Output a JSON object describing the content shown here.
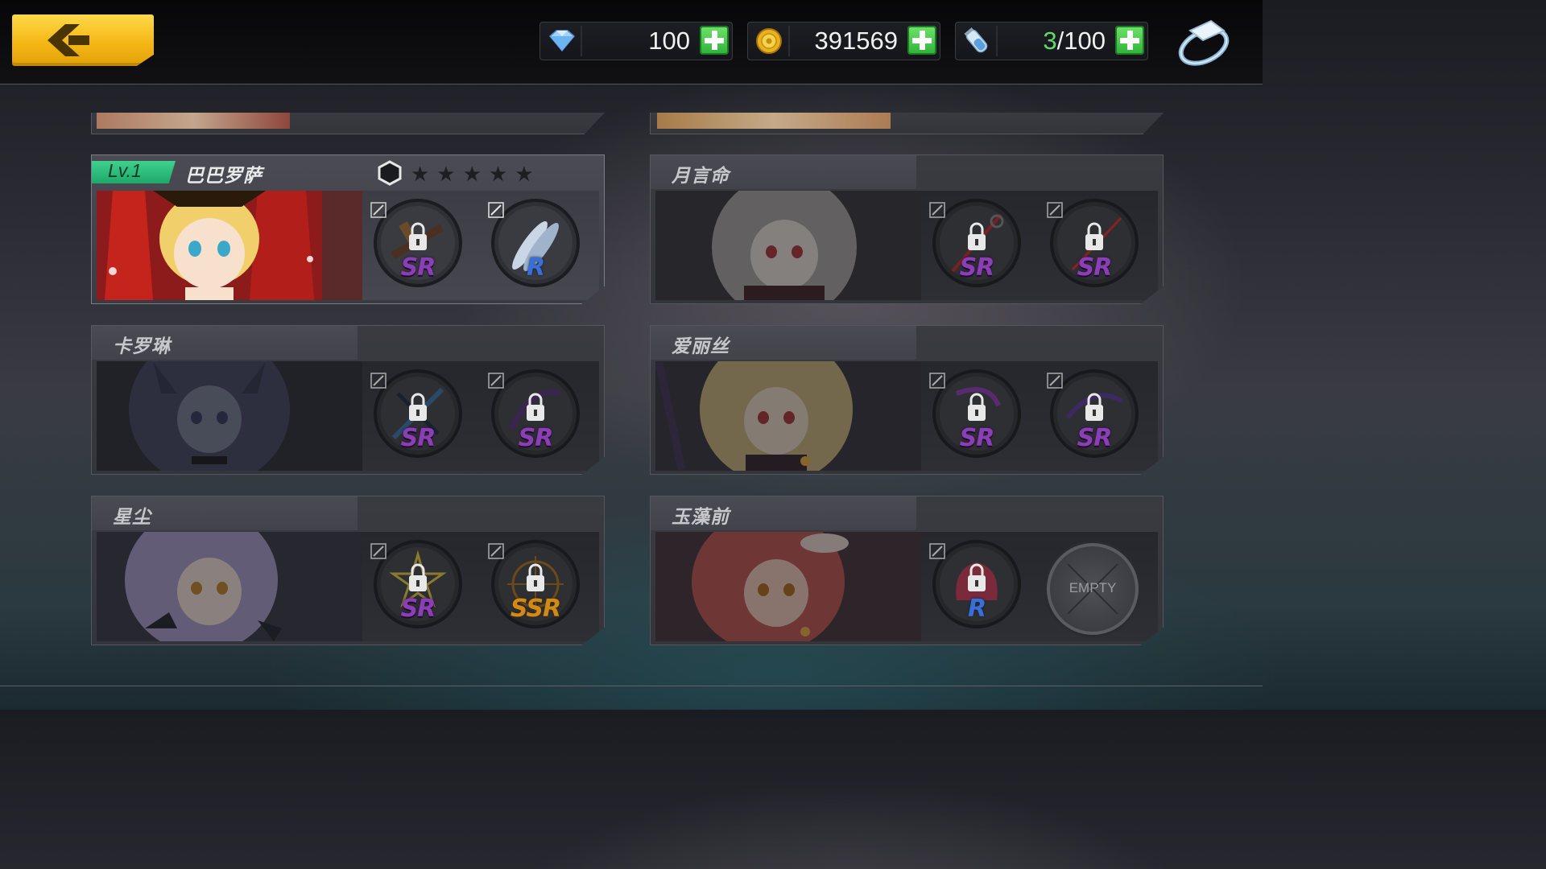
{
  "currencies": {
    "diamonds": {
      "icon": "diamond-icon",
      "value": "100"
    },
    "gold": {
      "icon": "gold-coin-icon",
      "value": "391569"
    },
    "stamina": {
      "icon": "stamina-vial-icon",
      "current": "3",
      "max": "/100"
    }
  },
  "characters": [
    {
      "name": "巴巴罗萨",
      "level": "Lv.1",
      "stars": "★★★★★",
      "slots": [
        {
          "rarity": "SR"
        },
        {
          "rarity": "R"
        }
      ]
    },
    {
      "name": "月言命",
      "slots": [
        {
          "rarity": "SR"
        },
        {
          "rarity": "SR"
        }
      ]
    },
    {
      "name": "卡罗琳",
      "slots": [
        {
          "rarity": "SR"
        },
        {
          "rarity": "SR"
        }
      ]
    },
    {
      "name": "爱丽丝",
      "slots": [
        {
          "rarity": "SR"
        },
        {
          "rarity": "SR"
        }
      ]
    },
    {
      "name": "星尘",
      "slots": [
        {
          "rarity": "SR"
        },
        {
          "rarity": "SSR"
        }
      ]
    },
    {
      "name": "玉藻前",
      "slots": [
        {
          "rarity": "R"
        },
        {
          "empty": "EMPTY"
        }
      ]
    }
  ],
  "colors": {
    "accent": "#f4b814",
    "level_green": "#2fc27a",
    "plus_green": "#3fbf45",
    "sr_purple": "#8a3fb5",
    "r_blue": "#3a6fd8",
    "ssr_orange": "#d08a1a"
  }
}
